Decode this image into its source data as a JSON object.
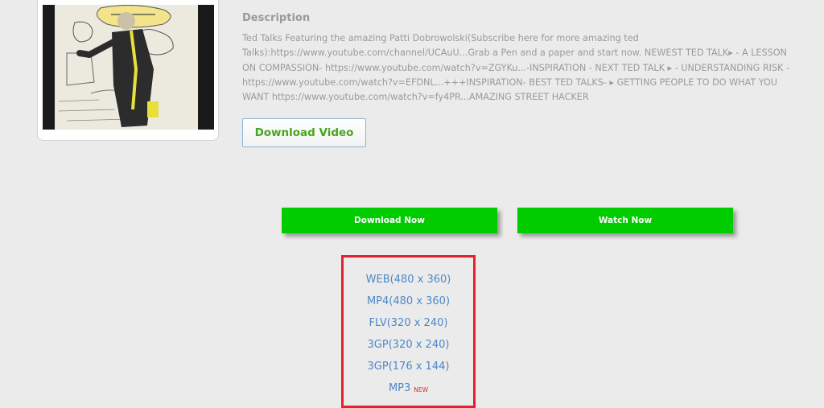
{
  "video": {
    "thumbnail_icon": "video-thumbnail-image"
  },
  "description": {
    "heading": "Description",
    "text": "Ted Talks Featuring the amazing Patti Dobrowolski(Subscribe here for more amazing ted Talks):https://www.youtube.com/channel/UCAuU...Grab a Pen and a paper and start now. NEWEST TED TALK▸ - A LESSON ON COMPASSION- https://www.youtube.com/watch?v=ZGYKu...-INSPIRATION - NEXT TED TALK ▸ - UNDERSTANDING RISK -https://www.youtube.com/watch?v=EFDNL...+++INSPIRATION- BEST TED TALKS- ▸ GETTING PEOPLE TO DO WHAT YOU WANT https://www.youtube.com/watch?v=fy4PR...AMAZING STREET HACKER"
  },
  "actions": {
    "download_video_label": "Download Video",
    "download_now_label": "Download Now",
    "watch_now_label": "Watch Now"
  },
  "formats": [
    {
      "label": "WEB(480 x 360)"
    },
    {
      "label": "MP4(480 x 360)"
    },
    {
      "label": "FLV(320 x 240)"
    },
    {
      "label": "3GP(320 x 240)"
    },
    {
      "label": "3GP(176 x 144)"
    },
    {
      "label": "MP3",
      "badge": "NEW"
    }
  ],
  "colors": {
    "background": "#ebebeb",
    "green_button": "#00cc00",
    "link_blue": "#4c88c9",
    "highlight_red": "#e1232f",
    "muted_text": "#9a9a9a"
  }
}
